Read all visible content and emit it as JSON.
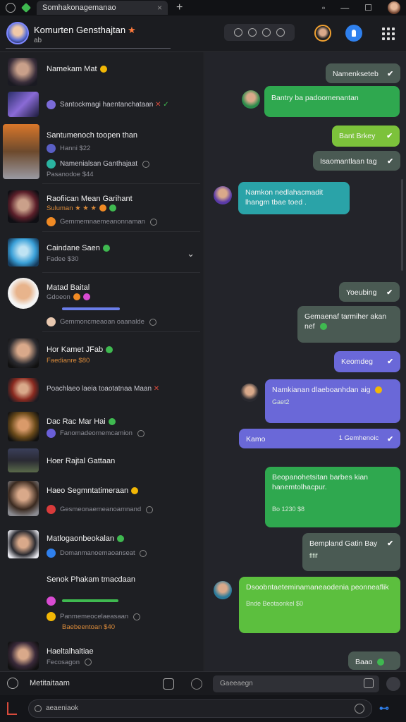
{
  "window": {
    "tab_title": "Somhakonagemanao",
    "tab_close": "×",
    "new_tab": "+",
    "controls": [
      "▫",
      "—",
      "☐"
    ]
  },
  "header": {
    "title": "Komurten Gensthajtan",
    "subtitle": "ab"
  },
  "sidebar": {
    "items": [
      {
        "name": "Namekam Mat",
        "sub": ""
      },
      {
        "name": "Santockmagi haentanchataan",
        "sub": ""
      },
      {
        "name": "Santumenoch toopen than",
        "sub": "Hanni  $22"
      },
      {
        "name": "Namenialsan Ganthajaat",
        "sub": "Pasanodoe  $44"
      },
      {
        "name": "Raofiican Mean Garihant",
        "sub": "Suluman ★ ★ ★"
      },
      {
        "name": "",
        "sub": "Gemmemnaemeanonnaman"
      },
      {
        "name": "Caindane Saen",
        "sub": "Fadee  $30"
      },
      {
        "name": "Matad Baital",
        "sub": "Gdoeon"
      },
      {
        "name": "",
        "sub": "Gemmoncmeaoan oaanalde"
      },
      {
        "name": "Hor Kamet JFab",
        "sub": "Faedianre  $80"
      },
      {
        "name": "Poachlaeo laeia toaotatnaa Maan",
        "sub": ""
      },
      {
        "name": "Dac Rac Mar Hai",
        "sub": ""
      },
      {
        "name": "",
        "sub": "Fanomadeornemcamion"
      },
      {
        "name": "Hoer Rajtal Gattaan",
        "sub": ""
      },
      {
        "name": "Haeo Segmntatimeraan",
        "sub": "Gesmeonaemeanoamnand"
      },
      {
        "name": "Matlogaonbeokalan",
        "sub": "Domanmanoemaoanseat"
      },
      {
        "name": "Senok Phakam tmacdaan",
        "sub": ""
      },
      {
        "name": "",
        "sub": "Panmemeocelaeasaan"
      },
      {
        "name": "",
        "sub": "Baebeentoan  $40"
      },
      {
        "name": "Haeltalhaltiae",
        "sub": "Fecosagon"
      }
    ]
  },
  "chat": {
    "messages": [
      {
        "text": "Namenkseteb",
        "meta": ""
      },
      {
        "text": "Bantry ba padoomenantan",
        "meta": ""
      },
      {
        "text": "Bant Brkey",
        "meta": ""
      },
      {
        "text": "Isaomantlaan tag",
        "meta": ""
      },
      {
        "text": "Namkon nedlahacmadit lhangm tbae toed .",
        "meta": ""
      },
      {
        "text": "Yoeubing",
        "meta": ""
      },
      {
        "text": "Gemaenaf tarmiher akan nef",
        "meta": ""
      },
      {
        "text": "Keomdeg",
        "meta": ""
      },
      {
        "text": "Namkianan dlaeboanhdan aig",
        "meta": "Gaet2"
      },
      {
        "text": "Kamo",
        "meta": "1 Gemhenoic"
      },
      {
        "text": "Beopanohetsitan barbes kian hanemtolhacpur.",
        "meta": "Bo   1230 $8"
      },
      {
        "text": "Bempland Gatin Bay",
        "meta": "flfif"
      },
      {
        "text": "Dsoobntaeteminamaneaodenia peonneaflik",
        "meta": "Bnde  Beotaonkel $0"
      },
      {
        "text": "Baao",
        "meta": ""
      }
    ]
  },
  "composer": {
    "left_label": "Metitaitaam",
    "placeholder": "Gaeeaegn"
  },
  "footer": {
    "search_placeholder": "aeaeniaok"
  }
}
